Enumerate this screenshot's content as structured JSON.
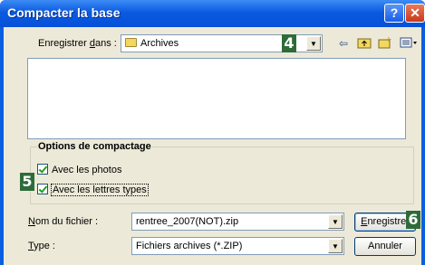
{
  "window": {
    "title": "Compacter la base",
    "help": "?",
    "close": "✕"
  },
  "location": {
    "label": "Enregistrer dans :",
    "folder": "Archives",
    "marker": "4"
  },
  "toolbar": [
    "back-icon",
    "up-folder-icon",
    "new-folder-icon",
    "view-menu-icon"
  ],
  "options": {
    "title": "Options de compactage",
    "marker": "5",
    "items": [
      {
        "label": "Avec les photos",
        "checked": true
      },
      {
        "label": "Avec les lettres types",
        "checked": true
      }
    ]
  },
  "filename": {
    "label": "Nom du fichier :",
    "value": "rentree_2007(NOT).zip"
  },
  "filetype": {
    "label": "Type :",
    "value": "Fichiers archives (*.ZIP)"
  },
  "buttons": {
    "save": "Enregistrer",
    "cancel": "Annuler",
    "marker": "6"
  }
}
